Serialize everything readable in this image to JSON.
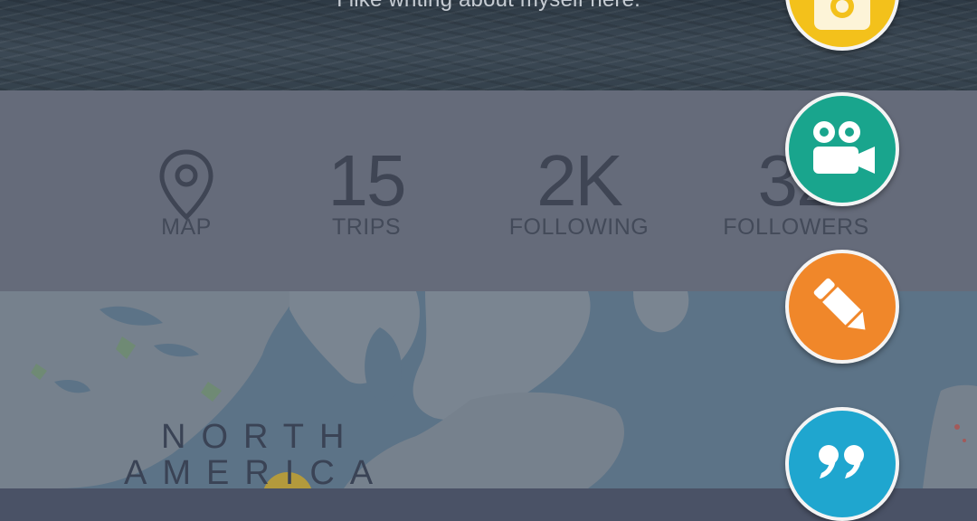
{
  "profile": {
    "bio": "I like writing about myself here."
  },
  "stats": [
    {
      "id": "map",
      "value": "",
      "label": "MAP"
    },
    {
      "id": "trips",
      "value": "15",
      "label": "TRIPS"
    },
    {
      "id": "following",
      "value": "2K",
      "label": "FOLLOWING"
    },
    {
      "id": "followers",
      "value": "32",
      "label": "FOLLOWERS"
    }
  ],
  "map": {
    "continent_line1": "NORTH",
    "continent_line2": "AMERICA"
  },
  "fab_menu": [
    {
      "id": "photo",
      "icon": "camera-icon",
      "color": "#f3c11b"
    },
    {
      "id": "video",
      "icon": "video-camera-icon",
      "color": "#19a58d"
    },
    {
      "id": "write",
      "icon": "pencil-icon",
      "color": "#f0872a"
    },
    {
      "id": "quote",
      "icon": "quote-icon",
      "color": "#1fa6cf"
    }
  ],
  "colors": {
    "overlay": "#656b7a",
    "stat_text": "#3f4554"
  }
}
